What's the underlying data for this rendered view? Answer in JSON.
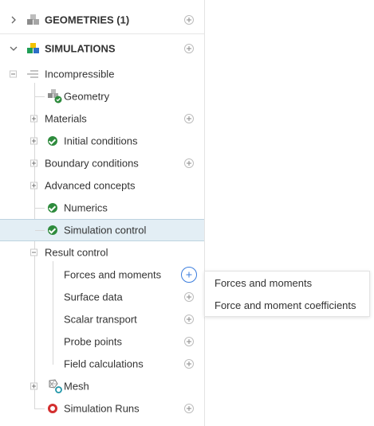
{
  "tree": {
    "geometries": {
      "label": "GEOMETRIES (1)"
    },
    "simulations": {
      "label": "SIMULATIONS"
    },
    "incompressible": {
      "label": "Incompressible"
    },
    "geometry": {
      "label": "Geometry"
    },
    "materials": {
      "label": "Materials"
    },
    "initial_conditions": {
      "label": "Initial conditions"
    },
    "boundary_conditions": {
      "label": "Boundary conditions"
    },
    "advanced_concepts": {
      "label": "Advanced concepts"
    },
    "numerics": {
      "label": "Numerics"
    },
    "simulation_control": {
      "label": "Simulation control"
    },
    "result_control": {
      "label": "Result control"
    },
    "forces_and_moments": {
      "label": "Forces and moments"
    },
    "surface_data": {
      "label": "Surface data"
    },
    "scalar_transport": {
      "label": "Scalar transport"
    },
    "probe_points": {
      "label": "Probe points"
    },
    "field_calculations": {
      "label": "Field calculations"
    },
    "mesh": {
      "label": "Mesh"
    },
    "simulation_runs": {
      "label": "Simulation Runs"
    }
  },
  "context_menu": {
    "items": [
      {
        "label": "Forces and moments"
      },
      {
        "label": "Force and moment coefficients"
      }
    ]
  },
  "colors": {
    "selected_bg": "#e3eef5",
    "check_green": "#2e8b3d",
    "run_red": "#d32f2f",
    "accent_blue": "#3b7ddd"
  },
  "icons": {
    "geometries": "geometry-cubes-icon",
    "simulations": "simulation-blocks-icon",
    "incompressible": "list-lines-icon",
    "geometry": "geometry-check-icon",
    "status_ok": "check-circle-icon",
    "mesh": "mesh-icon",
    "runs": "run-ring-icon"
  }
}
